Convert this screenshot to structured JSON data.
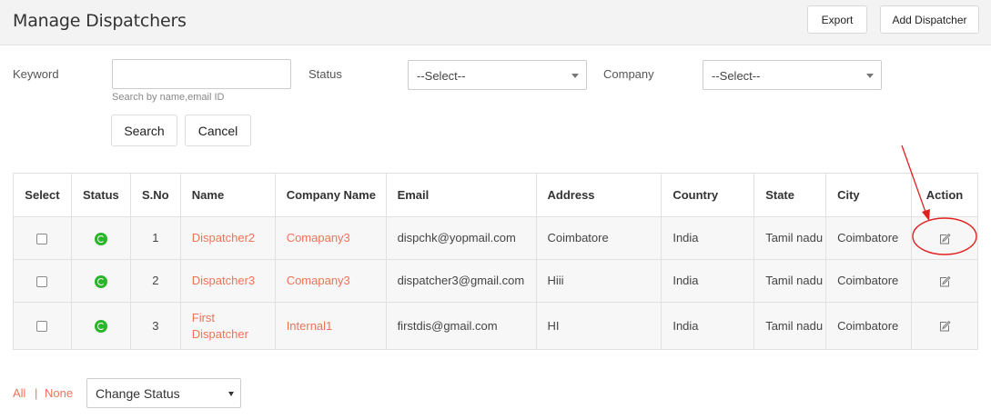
{
  "header": {
    "title": "Manage Dispatchers",
    "export_label": "Export",
    "add_label": "Add Dispatcher"
  },
  "filters": {
    "keyword_label": "Keyword",
    "keyword_value": "",
    "keyword_hint": "Search by name,email ID",
    "status_label": "Status",
    "status_value": "--Select--",
    "company_label": "Company",
    "company_value": "--Select--",
    "search_label": "Search",
    "cancel_label": "Cancel"
  },
  "table": {
    "columns": [
      "Select",
      "Status",
      "S.No",
      "Name",
      "Company Name",
      "Email",
      "Address",
      "Country",
      "State",
      "City",
      "Action"
    ],
    "rows": [
      {
        "sno": "1",
        "name": "Dispatcher2",
        "company": "Comapany3",
        "email": "dispchk@yopmail.com",
        "address": "Coimbatore",
        "country": "India",
        "state": "Tamil nadu",
        "city": "Coimbatore"
      },
      {
        "sno": "2",
        "name": "Dispatcher3",
        "company": "Comapany3",
        "email": "dispatcher3@gmail.com",
        "address": "Hiii",
        "country": "India",
        "state": "Tamil nadu",
        "city": "Coimbatore"
      },
      {
        "sno": "3",
        "name": "First Dispatcher",
        "company": "Internal1",
        "email": "firstdis@gmail.com",
        "address": "HI",
        "country": "India",
        "state": "Tamil nadu",
        "city": "Coimbatore"
      }
    ]
  },
  "footer": {
    "all_label": "All",
    "separator": "|",
    "none_label": "None",
    "change_status_value": "Change Status"
  },
  "colors": {
    "link": "#ee7357",
    "status_active": "#2bb52b",
    "annotation": "#e02020"
  },
  "icons": {
    "status": "status-active-icon",
    "action": "edit-icon"
  }
}
